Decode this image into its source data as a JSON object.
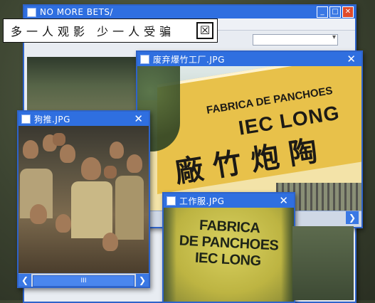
{
  "slogan": {
    "text": "多一人观影 少一人受骗",
    "close_glyph": "☒"
  },
  "back_window": {
    "title": "NO MORE BETS/",
    "minimize": "_",
    "maximize": "□",
    "close": "✕"
  },
  "factory_window": {
    "title": "废弃爆竹工厂.JPG",
    "close": "✕",
    "sign_line1": "FABRICA DE PANCHOES",
    "sign_line2": "IEC LONG",
    "sign_chars": "廠竹炮陶",
    "scroll_right": "❯"
  },
  "crowd_window": {
    "title": "狗推.JPG",
    "close": "✕",
    "scroll_left": "❮",
    "scroll_right": "❯",
    "scroll_thumb": "III"
  },
  "uniform_window": {
    "title": "工作服.JPG",
    "close": "✕",
    "shirt_text_1": "FABRICA",
    "shirt_text_2": "DE PANCHOES",
    "shirt_text_3": "IEC LONG"
  },
  "colors": {
    "titlebar": "#2f6fe0",
    "border": "#2e63c9",
    "close_red": "#e04a2a",
    "sign_yellow": "#e8c14a"
  }
}
